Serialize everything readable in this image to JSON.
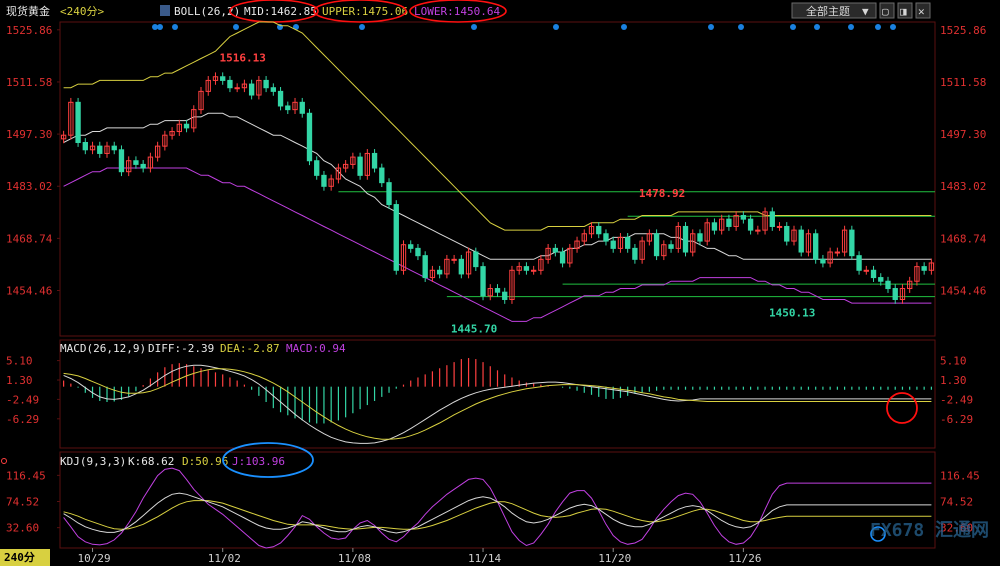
{
  "header": {
    "instrument": "现货黄金",
    "period_tag": "<240分>",
    "boll_label": "BOLL(26,2)",
    "mid": "MID:1462.85",
    "upper": "UPPER:1475.06",
    "lower": "LOWER:1450.64",
    "theme_button": "全部主题",
    "win_controls": [
      "▼",
      "▢",
      "◨",
      "✕"
    ]
  },
  "macd_header": {
    "label": "MACD(26,12,9)",
    "diff": "DIFF:-2.39",
    "dea": "DEA:-2.87",
    "macd": "MACD:0.94"
  },
  "kdj_header": {
    "label": "KDJ(9,3,3)",
    "k": "K:68.62",
    "d": "D:50.96",
    "j": "J:103.96"
  },
  "period_badge": "240分",
  "watermark": "FX678 汇通网",
  "colors": {
    "up": "#ff4040",
    "down": "#33d6a6",
    "mid": "#d8d8d8",
    "upper": "#d8d040",
    "lower": "#c040e0",
    "level": "#20c040",
    "tick": "#e03030",
    "highlight_red": "#ff1010",
    "highlight_blue": "#1a90ff"
  },
  "chart_data": [
    {
      "type": "candlestick",
      "name": "price",
      "y_ticks": [
        1525.86,
        1511.58,
        1497.3,
        1483.02,
        1468.74,
        1454.46
      ],
      "ylim": [
        1442,
        1528
      ],
      "x_ticks": [
        "10/29",
        "11/02",
        "11/08",
        "11/14",
        "11/20",
        "11/26"
      ],
      "x_tick_bars": [
        4,
        22,
        40,
        58,
        76,
        94
      ],
      "annotations": [
        {
          "bar": 21,
          "value": 1516.13,
          "text": "1516.13"
        },
        {
          "bar": 53,
          "value": 1445.7,
          "text": "1445.70"
        },
        {
          "bar": 79,
          "value": 1478.92,
          "text": "1478.92"
        },
        {
          "bar": 97,
          "value": 1450.13,
          "text": "1450.13"
        }
      ],
      "levels": [
        {
          "value": 1481.5,
          "from_bar": 38
        },
        {
          "value": 1474.8,
          "from_bar": 78
        },
        {
          "value": 1456.2,
          "from_bar": 69
        },
        {
          "value": 1452.8,
          "from_bar": 53
        }
      ],
      "closes": [
        1497,
        1506,
        1495,
        1493,
        1494,
        1492,
        1494,
        1493,
        1487,
        1490,
        1489,
        1488,
        1491,
        1494,
        1497,
        1498,
        1500,
        1499,
        1504,
        1509,
        1512,
        1513,
        1512,
        1510,
        1510,
        1511,
        1508,
        1512,
        1510,
        1509,
        1505,
        1504,
        1506,
        1503,
        1490,
        1486,
        1483,
        1485,
        1488,
        1489,
        1491,
        1486,
        1492,
        1488,
        1484,
        1478,
        1460,
        1467,
        1466,
        1464,
        1458,
        1460,
        1459,
        1463,
        1463,
        1459,
        1465,
        1461,
        1453,
        1455,
        1454,
        1452,
        1460,
        1461,
        1460,
        1460,
        1463,
        1466,
        1465,
        1462,
        1466,
        1468,
        1470,
        1472,
        1470,
        1468,
        1466,
        1469,
        1466,
        1463,
        1468,
        1470,
        1464,
        1467,
        1466,
        1472,
        1465,
        1470,
        1468,
        1473,
        1471,
        1474,
        1472,
        1475,
        1474,
        1471,
        1471,
        1476,
        1472,
        1472,
        1468,
        1471,
        1465,
        1470,
        1463,
        1462,
        1465,
        1465,
        1471,
        1464,
        1460,
        1460,
        1458,
        1457,
        1455,
        1452,
        1455,
        1457,
        1461,
        1460,
        1462
      ],
      "mid": [
        1495,
        1496,
        1497,
        1497,
        1498,
        1498,
        1499,
        1499,
        1499,
        1499,
        1499,
        1499,
        1500,
        1500,
        1501,
        1501,
        1501,
        1501,
        1502,
        1502,
        1503,
        1503,
        1503,
        1502,
        1502,
        1501,
        1500,
        1499,
        1498,
        1497,
        1497,
        1496,
        1495,
        1494,
        1493,
        1492,
        1490,
        1489,
        1487,
        1485,
        1484,
        1483,
        1481,
        1480,
        1478,
        1477,
        1476,
        1475,
        1474,
        1473,
        1472,
        1471,
        1470,
        1469,
        1468,
        1467,
        1466,
        1465,
        1464,
        1463,
        1463,
        1463,
        1463,
        1463,
        1463,
        1463,
        1464,
        1464,
        1465,
        1465,
        1466,
        1466,
        1467,
        1467,
        1468,
        1468,
        1469,
        1469,
        1469,
        1470,
        1470,
        1470,
        1470,
        1470,
        1469,
        1469,
        1468,
        1468,
        1467,
        1466,
        1466,
        1465,
        1464,
        1464,
        1463,
        1463,
        1463,
        1463,
        1463,
        1463,
        1463,
        1463,
        1463,
        1463,
        1463,
        1463,
        1463,
        1463,
        1463,
        1463,
        1463,
        1463,
        1463,
        1463,
        1463,
        1463,
        1463,
        1463,
        1463,
        1463,
        1463
      ],
      "upper": [
        1510,
        1510,
        1511,
        1511,
        1511,
        1512,
        1512,
        1512,
        1512,
        1512,
        1512,
        1512,
        1513,
        1513,
        1514,
        1514,
        1515,
        1516,
        1517,
        1518,
        1519,
        1520,
        1522,
        1524,
        1525,
        1526,
        1527,
        1528,
        1528,
        1528,
        1527,
        1527,
        1526,
        1525,
        1523,
        1521,
        1519,
        1517,
        1515,
        1513,
        1511,
        1509,
        1507,
        1505,
        1503,
        1501,
        1499,
        1497,
        1495,
        1493,
        1491,
        1489,
        1487,
        1485,
        1483,
        1481,
        1479,
        1477,
        1475,
        1473,
        1472,
        1471,
        1471,
        1471,
        1471,
        1471,
        1471,
        1472,
        1472,
        1472,
        1472,
        1472,
        1472,
        1473,
        1473,
        1473,
        1473,
        1474,
        1474,
        1474,
        1475,
        1475,
        1475,
        1475,
        1475,
        1476,
        1476,
        1476,
        1476,
        1476,
        1476,
        1476,
        1476,
        1476,
        1476,
        1476,
        1476,
        1475,
        1475,
        1475,
        1475,
        1475,
        1475,
        1475,
        1475,
        1475,
        1475,
        1475,
        1475,
        1475,
        1475,
        1475,
        1475,
        1475,
        1475,
        1475,
        1475,
        1475,
        1475,
        1475,
        1475
      ],
      "lower": [
        1483,
        1484,
        1485,
        1486,
        1487,
        1487,
        1488,
        1488,
        1488,
        1488,
        1488,
        1488,
        1488,
        1488,
        1488,
        1488,
        1488,
        1488,
        1487,
        1486,
        1486,
        1485,
        1484,
        1484,
        1483,
        1483,
        1482,
        1481,
        1480,
        1479,
        1478,
        1477,
        1476,
        1475,
        1474,
        1473,
        1472,
        1471,
        1470,
        1469,
        1468,
        1467,
        1466,
        1465,
        1464,
        1463,
        1462,
        1461,
        1460,
        1459,
        1458,
        1457,
        1456,
        1455,
        1454,
        1453,
        1452,
        1451,
        1450,
        1449,
        1448,
        1447,
        1446,
        1446,
        1446,
        1447,
        1447,
        1448,
        1449,
        1450,
        1451,
        1452,
        1453,
        1453,
        1453,
        1454,
        1454,
        1455,
        1455,
        1455,
        1456,
        1456,
        1456,
        1456,
        1457,
        1457,
        1457,
        1457,
        1458,
        1458,
        1458,
        1458,
        1458,
        1458,
        1458,
        1458,
        1457,
        1457,
        1456,
        1456,
        1455,
        1455,
        1454,
        1454,
        1453,
        1452,
        1452,
        1452,
        1452,
        1451,
        1451,
        1451,
        1451,
        1451,
        1451,
        1451,
        1451,
        1451,
        1451,
        1451,
        1451
      ]
    },
    {
      "type": "bar+line",
      "name": "macd",
      "y_ticks": [
        5.1,
        1.3,
        -2.49,
        -6.29
      ],
      "ylim": [
        -12,
        6
      ],
      "diff": [
        2.2,
        1.6,
        0.8,
        -0.2,
        -1.2,
        -2.0,
        -2.4,
        -2.5,
        -2.3,
        -2.0,
        -1.4,
        -0.7,
        0.2,
        1.2,
        2.2,
        3.0,
        3.6,
        4.0,
        4.2,
        4.2,
        4.0,
        3.7,
        3.4,
        3.0,
        2.6,
        2.1,
        1.4,
        0.5,
        -0.6,
        -1.8,
        -3.0,
        -4.2,
        -5.4,
        -6.5,
        -7.5,
        -8.4,
        -9.2,
        -9.9,
        -10.4,
        -10.8,
        -11.0,
        -11.1,
        -11.1,
        -11.0,
        -10.7,
        -10.3,
        -9.7,
        -9.0,
        -8.2,
        -7.3,
        -6.4,
        -5.5,
        -4.6,
        -3.8,
        -3.0,
        -2.3,
        -1.7,
        -1.2,
        -0.8,
        -0.5,
        -0.3,
        -0.1,
        0.1,
        0.3,
        0.5,
        0.7,
        0.8,
        0.9,
        0.9,
        0.8,
        0.6,
        0.4,
        0.2,
        0.0,
        -0.2,
        -0.4,
        -0.6,
        -0.8,
        -1.0,
        -1.3,
        -1.6,
        -1.9,
        -2.2,
        -2.5,
        -2.7,
        -2.8,
        -2.7,
        -2.6,
        -2.4,
        -2.4,
        -2.4,
        -2.4,
        -2.4,
        -2.4,
        -2.4,
        -2.4,
        -2.4,
        -2.4,
        -2.4,
        -2.4,
        -2.4,
        -2.4,
        -2.4,
        -2.4,
        -2.4,
        -2.4,
        -2.4,
        -2.4,
        -2.4,
        -2.4,
        -2.4,
        -2.4,
        -2.4,
        -2.4,
        -2.4,
        -2.4,
        -2.4,
        -2.4,
        -2.4,
        -2.4,
        -2.4
      ],
      "dea": [
        2.6,
        2.4,
        2.1,
        1.6,
        1.0,
        0.4,
        -0.2,
        -0.7,
        -1.1,
        -1.3,
        -1.3,
        -1.2,
        -0.9,
        -0.4,
        0.2,
        0.9,
        1.5,
        2.1,
        2.6,
        3.0,
        3.3,
        3.5,
        3.5,
        3.4,
        3.2,
        2.9,
        2.5,
        2.0,
        1.4,
        0.7,
        -0.1,
        -1.0,
        -2.0,
        -3.0,
        -4.0,
        -5.0,
        -5.9,
        -6.8,
        -7.6,
        -8.3,
        -8.9,
        -9.4,
        -9.8,
        -10.1,
        -10.3,
        -10.3,
        -10.2,
        -10.0,
        -9.6,
        -9.1,
        -8.5,
        -7.8,
        -7.1,
        -6.3,
        -5.5,
        -4.8,
        -4.1,
        -3.4,
        -2.8,
        -2.3,
        -1.8,
        -1.4,
        -1.0,
        -0.7,
        -0.4,
        -0.2,
        0.0,
        0.2,
        0.3,
        0.4,
        0.4,
        0.4,
        0.3,
        0.2,
        0.1,
        -0.1,
        -0.3,
        -0.5,
        -0.7,
        -0.9,
        -1.2,
        -1.4,
        -1.7,
        -2.0,
        -2.2,
        -2.5,
        -2.6,
        -2.7,
        -2.8,
        -2.9,
        -2.9,
        -2.9,
        -2.9,
        -2.9,
        -2.9,
        -2.9,
        -2.9,
        -2.9,
        -2.9,
        -2.9,
        -2.9,
        -2.9,
        -2.9,
        -2.9,
        -2.9,
        -2.9,
        -2.9,
        -2.9,
        -2.9,
        -2.9,
        -2.9,
        -2.9,
        -2.9,
        -2.9,
        -2.9,
        -2.9,
        -2.9,
        -2.9,
        -2.9,
        -2.9,
        -2.9
      ],
      "macd": [
        1.2,
        0.6,
        -0.2,
        -1.2,
        -2.2,
        -2.8,
        -3.0,
        -2.9,
        -2.6,
        -1.9,
        -0.9,
        0.3,
        1.6,
        2.8,
        3.8,
        4.4,
        4.6,
        4.4,
        4.0,
        3.6,
        3.2,
        2.8,
        2.4,
        1.8,
        1.2,
        0.4,
        -0.6,
        -1.8,
        -3.0,
        -4.2,
        -5.0,
        -5.6,
        -6.2,
        -6.6,
        -7.0,
        -7.2,
        -7.2,
        -7.0,
        -6.6,
        -6.0,
        -5.2,
        -4.4,
        -3.6,
        -2.8,
        -2.0,
        -1.2,
        -0.4,
        0.4,
        1.2,
        1.8,
        2.4,
        3.0,
        3.6,
        4.2,
        4.8,
        5.4,
        5.6,
        5.4,
        4.8,
        4.0,
        3.2,
        2.4,
        1.8,
        1.2,
        0.8,
        0.6,
        0.4,
        0.2,
        0.0,
        -0.2,
        -0.4,
        -0.8,
        -1.2,
        -1.6,
        -2.0,
        -2.4,
        -2.4,
        -2.2,
        -1.8,
        -1.4,
        -1.2,
        -1.0,
        -0.8,
        -0.6,
        -0.6,
        -0.6,
        -0.6,
        -0.6,
        -0.6,
        -0.6,
        -0.6,
        -0.6,
        -0.6,
        -0.6,
        -0.6,
        -0.6,
        -0.6,
        -0.6,
        -0.6,
        -0.6,
        -0.6,
        -0.6,
        -0.6,
        -0.6,
        -0.6,
        -0.6,
        -0.6,
        -0.6,
        -0.6,
        -0.6,
        -0.6,
        -0.6,
        -0.6,
        -0.6,
        -0.6,
        -0.6,
        -0.6,
        -0.6,
        -0.6,
        -0.6,
        -0.6
      ]
    },
    {
      "type": "line",
      "name": "kdj",
      "y_ticks": [
        116.45,
        74.52,
        32.6
      ],
      "ylim": [
        0,
        125
      ],
      "k": [
        55,
        48,
        40,
        34,
        30,
        27,
        25,
        25,
        28,
        34,
        42,
        52,
        62,
        72,
        80,
        86,
        88,
        86,
        82,
        78,
        74,
        70,
        66,
        60,
        54,
        48,
        42,
        36,
        32,
        30,
        30,
        32,
        36,
        42,
        40,
        36,
        32,
        28,
        26,
        26,
        30,
        34,
        36,
        34,
        30,
        26,
        24,
        26,
        30,
        34,
        40,
        46,
        52,
        58,
        64,
        70,
        76,
        80,
        82,
        80,
        74,
        66,
        56,
        48,
        42,
        40,
        42,
        46,
        52,
        58,
        64,
        68,
        70,
        68,
        62,
        54,
        46,
        40,
        36,
        34,
        34,
        38,
        44,
        50,
        56,
        62,
        66,
        68,
        66,
        60,
        52,
        44,
        38,
        34,
        32,
        34,
        40,
        50,
        60,
        66,
        69,
        69,
        69,
        69,
        69,
        69,
        69,
        69,
        69,
        69,
        69,
        69,
        69,
        69,
        69,
        69,
        69,
        69,
        69,
        69,
        69
      ],
      "d": [
        58,
        55,
        51,
        46,
        42,
        38,
        34,
        31,
        30,
        31,
        34,
        38,
        44,
        50,
        57,
        64,
        70,
        74,
        76,
        76,
        76,
        74,
        72,
        68,
        64,
        60,
        56,
        52,
        48,
        44,
        41,
        38,
        37,
        37,
        37,
        37,
        36,
        34,
        32,
        31,
        30,
        31,
        32,
        33,
        33,
        32,
        31,
        30,
        30,
        31,
        33,
        36,
        40,
        44,
        49,
        54,
        59,
        64,
        68,
        72,
        74,
        74,
        71,
        66,
        61,
        56,
        52,
        50,
        49,
        50,
        52,
        56,
        59,
        62,
        63,
        62,
        59,
        55,
        51,
        47,
        44,
        42,
        42,
        44,
        47,
        51,
        55,
        59,
        62,
        62,
        60,
        56,
        52,
        48,
        44,
        42,
        42,
        44,
        47,
        49,
        51,
        51,
        51,
        51,
        51,
        51,
        51,
        51,
        51,
        51,
        51,
        51,
        51,
        51,
        51,
        51,
        51,
        51,
        51,
        51,
        51
      ],
      "j": [
        49,
        34,
        18,
        10,
        6,
        5,
        7,
        13,
        24,
        40,
        58,
        80,
        98,
        116,
        126,
        128,
        124,
        110,
        94,
        82,
        70,
        62,
        54,
        44,
        34,
        24,
        14,
        4,
        0,
        2,
        8,
        20,
        34,
        52,
        46,
        34,
        24,
        16,
        14,
        16,
        30,
        40,
        44,
        36,
        24,
        14,
        10,
        18,
        30,
        40,
        54,
        66,
        76,
        86,
        94,
        102,
        110,
        112,
        110,
        96,
        74,
        50,
        26,
        12,
        4,
        8,
        22,
        38,
        58,
        74,
        88,
        92,
        92,
        80,
        60,
        38,
        20,
        10,
        6,
        8,
        14,
        30,
        48,
        62,
        74,
        84,
        88,
        86,
        74,
        56,
        36,
        20,
        10,
        6,
        8,
        18,
        36,
        62,
        86,
        100,
        104,
        104,
        104,
        104,
        104,
        104,
        104,
        104,
        104,
        104,
        104,
        104,
        104,
        104,
        104,
        104,
        104,
        104,
        104,
        104,
        104
      ]
    }
  ]
}
